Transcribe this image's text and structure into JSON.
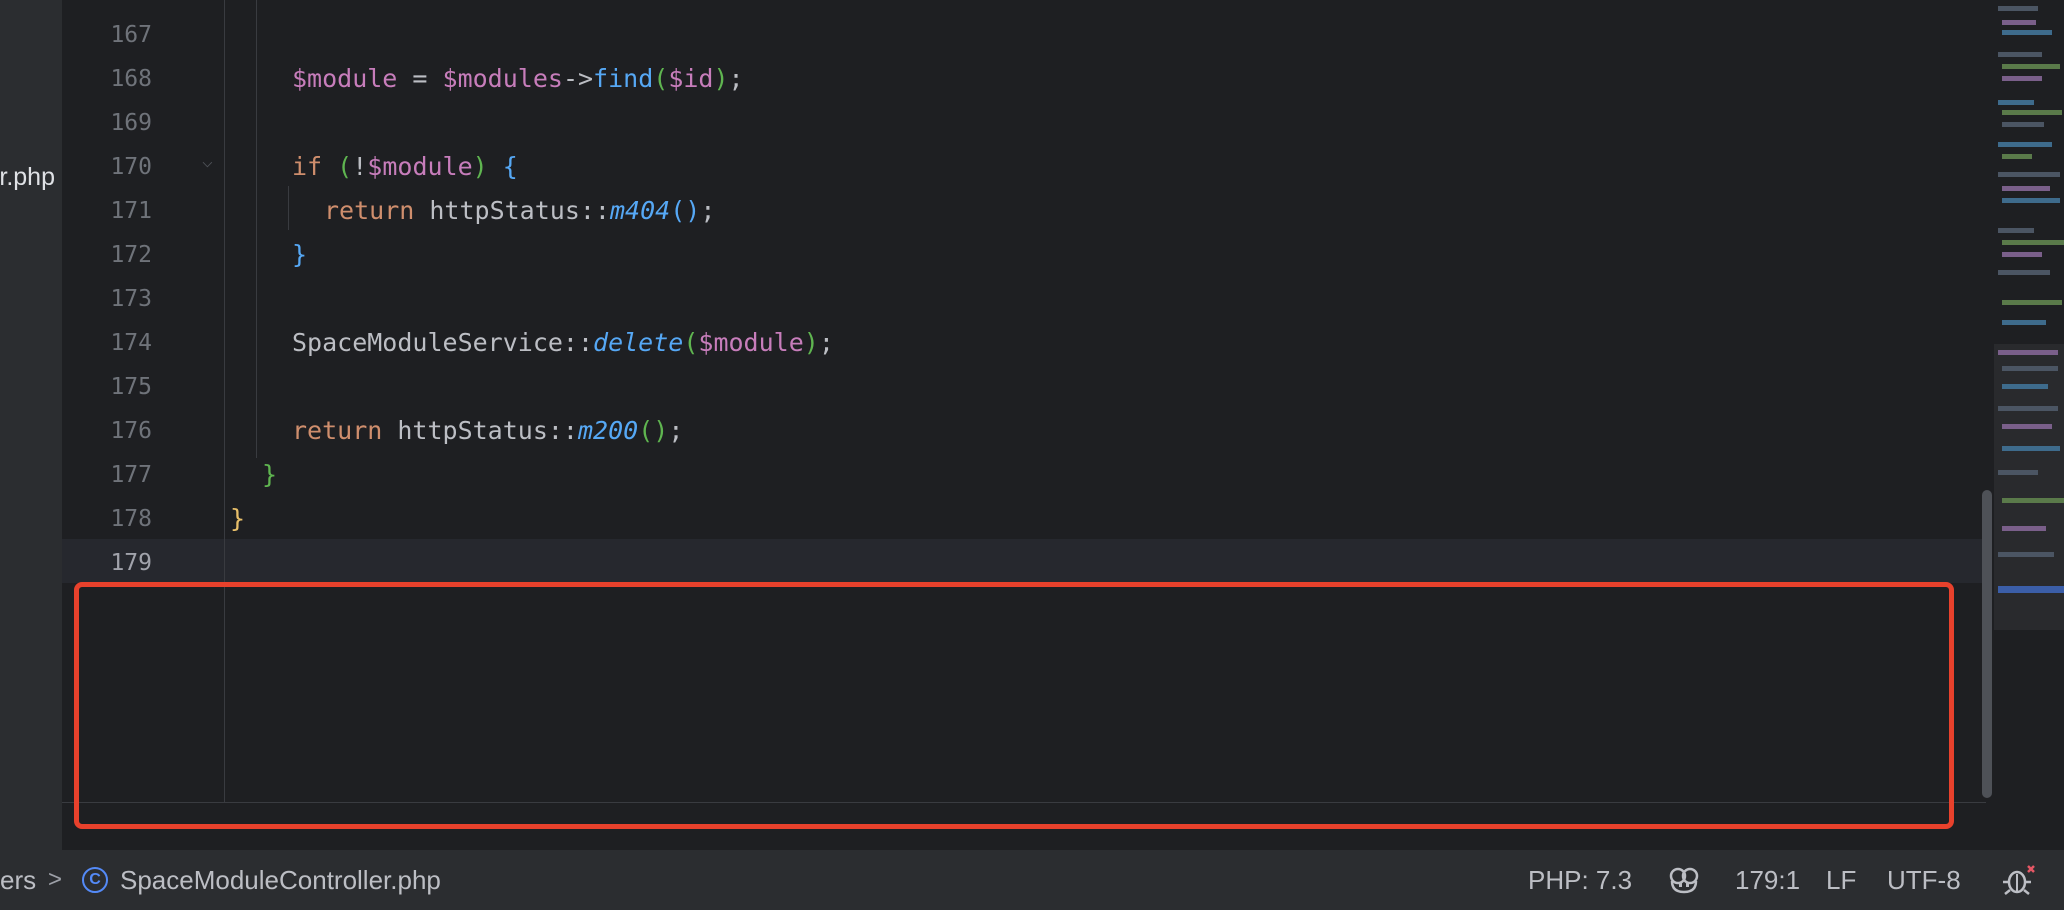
{
  "project_panel": {
    "partial_filename": "r.php"
  },
  "editor": {
    "line_numbers": [
      "167",
      "168",
      "169",
      "170",
      "171",
      "172",
      "173",
      "174",
      "175",
      "176",
      "177",
      "178",
      "179"
    ],
    "current_line": "179",
    "code": {
      "l168_var": "$module",
      "l168_eq": " = ",
      "l168_var2": "$modules",
      "l168_arrow": "->",
      "l168_fn": "find",
      "l168_open": "(",
      "l168_arg": "$id",
      "l168_close": ")",
      "l168_semi": ";",
      "l170_kw": "if",
      "l170_sp": " ",
      "l170_open": "(",
      "l170_not": "!",
      "l170_var": "$module",
      "l170_close": ")",
      "l170_brace": " {",
      "l171_kw": "return",
      "l171_cls": " httpStatus::",
      "l171_fn": "m404",
      "l171_parens": "()",
      "l171_semi": ";",
      "l172_brace": "}",
      "l174_cls": "SpaceModuleService::",
      "l174_fn": "delete",
      "l174_open": "(",
      "l174_var": "$module",
      "l174_close": ")",
      "l174_semi": ";",
      "l176_kw": "return",
      "l176_cls": " httpStatus::",
      "l176_fn": "m200",
      "l176_parens": "()",
      "l176_semi": ";",
      "l177_brace": "}",
      "l178_brace": "}"
    }
  },
  "status_bar": {
    "breadcrumb_prev": "ers",
    "breadcrumb_sep": ">",
    "class_icon": "class-icon",
    "class_icon_letter": "C",
    "filename": "SpaceModuleController.php",
    "php_version": "PHP: 7.3",
    "copilot_icon": "copilot-icon",
    "cursor_position": "179:1",
    "line_separator": "LF",
    "encoding": "UTF-8",
    "debug_icon": "debug-icon"
  },
  "colors": {
    "highlight_box": "#e8412c",
    "background": "#1e1f22",
    "panel": "#2b2d30"
  }
}
